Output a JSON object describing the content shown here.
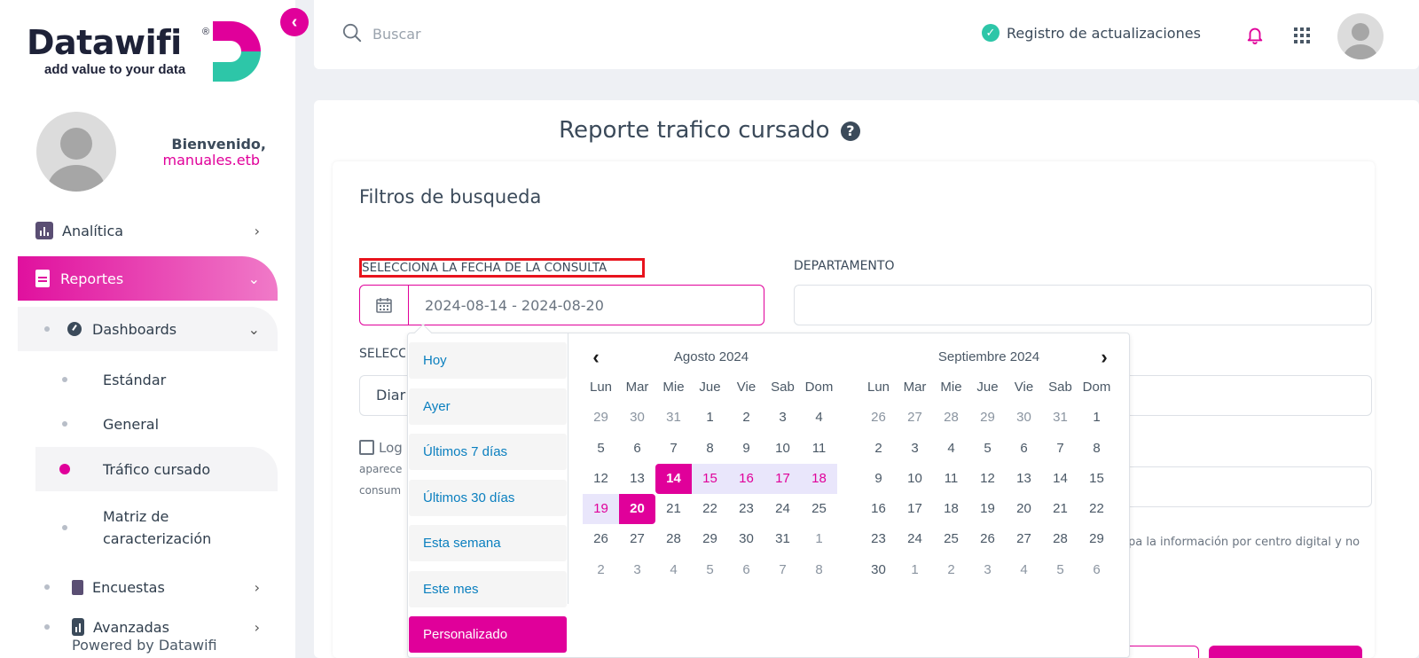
{
  "brand": {
    "name": "Datawifi",
    "registered": "®",
    "tagline": "add value to your data",
    "colors": {
      "primary": "#e0009a",
      "accent": "#2dc6a8",
      "dark": "#1e2238"
    }
  },
  "sidebar": {
    "welcome": "Bienvenido,",
    "username": "manuales.etb",
    "items": [
      {
        "label": "Analítica",
        "icon": "bar-chart-icon"
      },
      {
        "label": "Reportes",
        "icon": "document-icon"
      },
      {
        "label": "Dashboards",
        "icon": "gauge-icon"
      },
      {
        "label": "Estándar"
      },
      {
        "label": "General"
      },
      {
        "label": "Tráfico cursado"
      },
      {
        "label": "Matriz de caracterización",
        "line1": "Matriz de",
        "line2": "caracterización"
      },
      {
        "label": "Encuestas",
        "icon": "clipboard-icon"
      },
      {
        "label": "Avanzadas",
        "icon": "bar-chart-icon"
      }
    ],
    "powered_by": "Powered by Datawifi"
  },
  "header": {
    "search_placeholder": "Buscar",
    "updates_label": "Registro de actualizaciones"
  },
  "main": {
    "title": "Reporte trafico cursado",
    "filters_title": "Filtros de busqueda",
    "date_label": "SELECCIONA LA FECHA DE LA CONSULTA",
    "date_value": "2024-08-14 - 2024-08-20",
    "dept_label": "DEPARTAMENTO",
    "select_label_partial": "SELECC",
    "period_partial": "Diar",
    "log_label_partial": "Log",
    "note_line1_partial": "aparece",
    "note_line2_partial": "consum",
    "right_note": "pa la información por centro digital y no"
  },
  "picker": {
    "ranges": [
      "Hoy",
      "Ayer",
      "Últimos 7 días",
      "Últimos 30 días",
      "Esta semana",
      "Este mes",
      "Personalizado"
    ],
    "active_range": "Personalizado",
    "weekdays": [
      "Lun",
      "Mar",
      "Mie",
      "Jue",
      "Vie",
      "Sab",
      "Dom"
    ],
    "left_month": {
      "title": "Agosto 2024",
      "weeks": [
        [
          "29",
          "30",
          "31",
          "1",
          "2",
          "3",
          "4"
        ],
        [
          "5",
          "6",
          "7",
          "8",
          "9",
          "10",
          "11"
        ],
        [
          "12",
          "13",
          "14",
          "15",
          "16",
          "17",
          "18"
        ],
        [
          "19",
          "20",
          "21",
          "22",
          "23",
          "24",
          "25"
        ],
        [
          "26",
          "27",
          "28",
          "29",
          "30",
          "31",
          "1"
        ],
        [
          "2",
          "3",
          "4",
          "5",
          "6",
          "7",
          "8"
        ]
      ]
    },
    "right_month": {
      "title": "Septiembre 2024",
      "weeks": [
        [
          "26",
          "27",
          "28",
          "29",
          "30",
          "31",
          "1"
        ],
        [
          "2",
          "3",
          "4",
          "5",
          "6",
          "7",
          "8"
        ],
        [
          "9",
          "10",
          "11",
          "12",
          "13",
          "14",
          "15"
        ],
        [
          "16",
          "17",
          "18",
          "19",
          "20",
          "21",
          "22"
        ],
        [
          "23",
          "24",
          "25",
          "26",
          "27",
          "28",
          "29"
        ],
        [
          "30",
          "1",
          "2",
          "3",
          "4",
          "5",
          "6"
        ]
      ]
    },
    "range_start": "14",
    "range_end": "20"
  }
}
